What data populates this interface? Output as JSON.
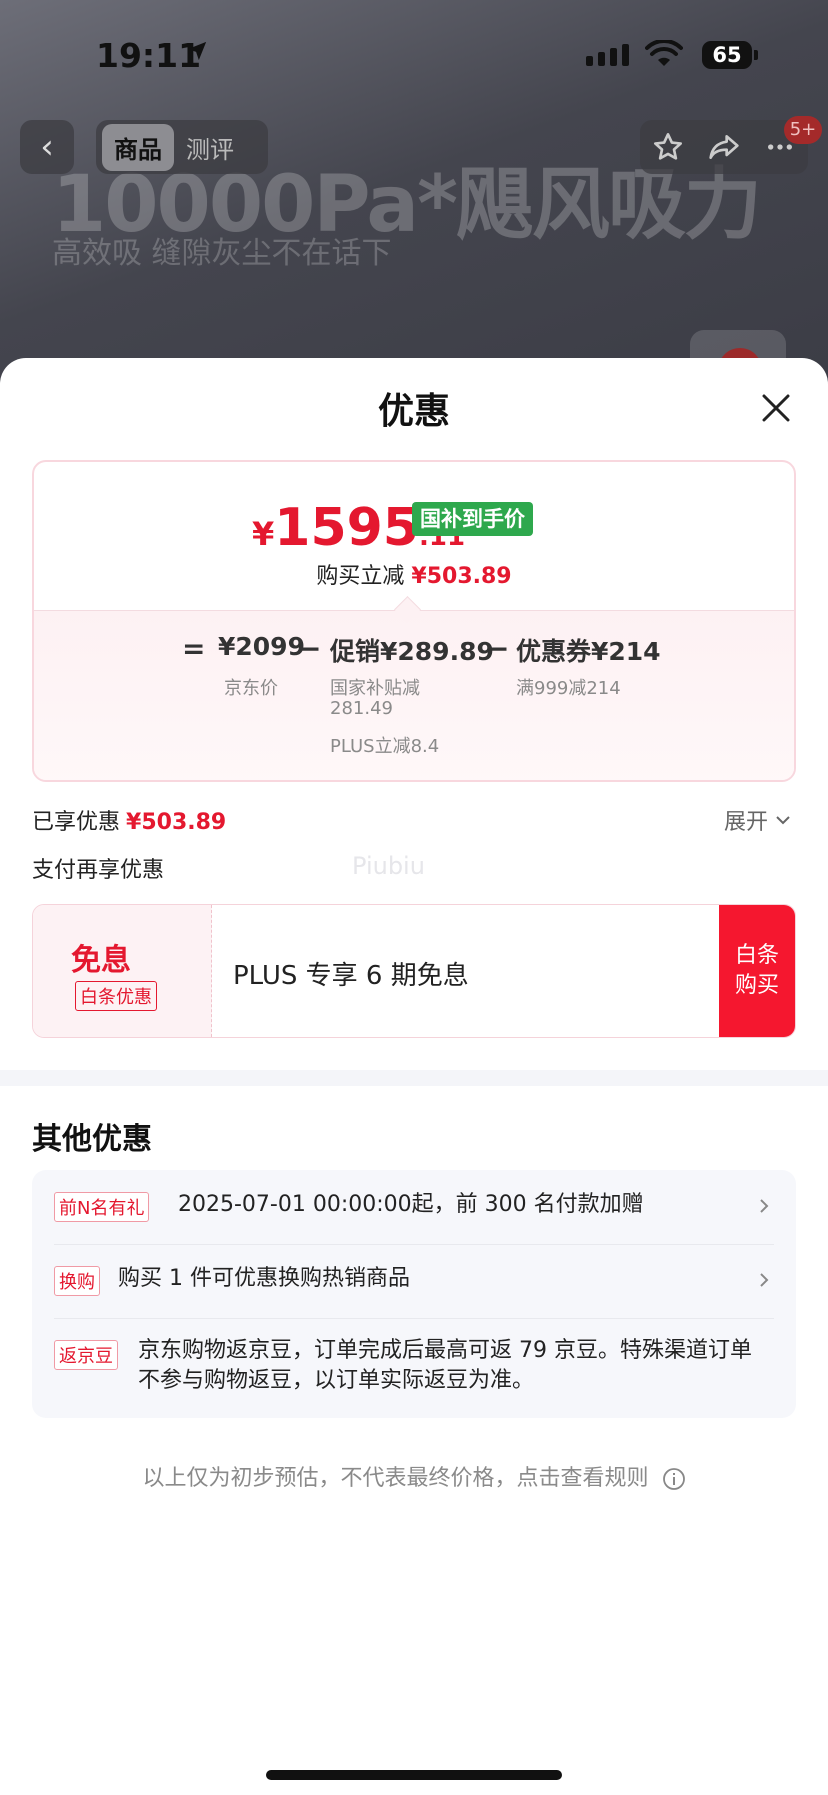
{
  "status_bar": {
    "time": "19:11",
    "battery": "65"
  },
  "background_page": {
    "banner_title": "10000Pa*飓风吸力",
    "banner_subtitle": "高效吸 缝隙灰尘不在话下",
    "tabs": [
      "商品",
      "测评"
    ],
    "badge": "5+"
  },
  "sheet": {
    "title": "优惠"
  },
  "price_card": {
    "currency": "¥",
    "final_int": "1595",
    "final_dec": ".11",
    "tag": "国补到手价",
    "instant_label": "购买立减",
    "instant_value": "¥503.89",
    "eq": "=",
    "jd_price": "¥2099",
    "jd_label": "京东价",
    "minus": "−",
    "promo": "促销¥289.89",
    "promo_note1": "国家补贴减",
    "promo_note2": "281.49",
    "promo_note3": "PLUS立减8.4",
    "coupon": "优惠券¥214",
    "coupon_note": "满999减214"
  },
  "enjoyed": {
    "label": "已享优惠",
    "value": "¥503.89",
    "expand": "展开"
  },
  "pay_extra": {
    "title": "支付再享优惠",
    "watermark": "Piubiu"
  },
  "interest_free": {
    "main": "免息",
    "tag": "白条优惠",
    "desc": "PLUS 专享 6 期免息",
    "buy_line1": "白条",
    "buy_line2": "购买"
  },
  "other": {
    "title": "其他优惠",
    "items": [
      {
        "tag": "前N名有礼",
        "text": "2025-07-01 00:00:00起，前 300 名付款加赠"
      },
      {
        "tag": "换购",
        "text": "购买 1 件可优惠换购热销商品"
      },
      {
        "tag": "返京豆",
        "text": "京东购物返京豆，订单完成后最高可返 79 京豆。特殊渠道订单不参与购物返豆，以订单实际返豆为准。"
      }
    ]
  },
  "footnote": "以上仅为初步预估，不代表最终价格，点击查看规则",
  "colors": {
    "accent_red": "#e4182f",
    "tag_green": "#2ea84d",
    "buy_red": "#f5172f"
  }
}
